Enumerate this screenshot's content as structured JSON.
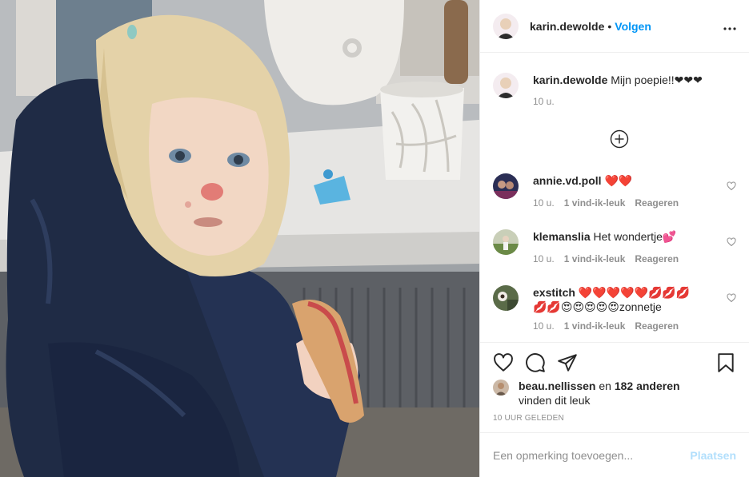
{
  "post": {
    "author": "karin.dewolde",
    "follow_label": "Volgen",
    "more_label": "•••",
    "dot": "•"
  },
  "caption": {
    "author": "karin.dewolde",
    "text": "Mijn poepie!!❤❤❤",
    "time": "10 u."
  },
  "comments": [
    {
      "author": "annie.vd.poll",
      "text": "❤️❤️",
      "time": "10 u.",
      "likes": "1 vind-ik-leuk",
      "reply": "Reageren",
      "avatar_color": "#3a3f6b"
    },
    {
      "author": "klemanslia",
      "text": "Het wondertje💕",
      "time": "10 u.",
      "likes": "1 vind-ik-leuk",
      "reply": "Reageren",
      "avatar_color": "#7d8f5a"
    },
    {
      "author": "exstitch",
      "text": "❤️❤️❤️❤️❤️💋💋💋💋💋😍😍😍😍😍zonnetje",
      "time": "10 u.",
      "likes": "1 vind-ik-leuk",
      "reply": "Reageren",
      "avatar_color": "#4a5a3e"
    }
  ],
  "likes": {
    "user": "beau.nellissen",
    "connector": " en ",
    "others": "182 anderen",
    "suffix": "vinden dit leuk"
  },
  "timestamp": "10 UUR GELEDEN",
  "add_comment": {
    "placeholder": "Een opmerking toevoegen...",
    "post_label": "Plaatsen"
  },
  "icons": [
    "heart-icon",
    "comment-icon",
    "share-icon",
    "bookmark-icon",
    "plus-circle-icon",
    "more-icon"
  ],
  "colors": {
    "accent": "#0095f6",
    "post_disabled": "#b2dffc",
    "muted": "#8e8e8e"
  }
}
